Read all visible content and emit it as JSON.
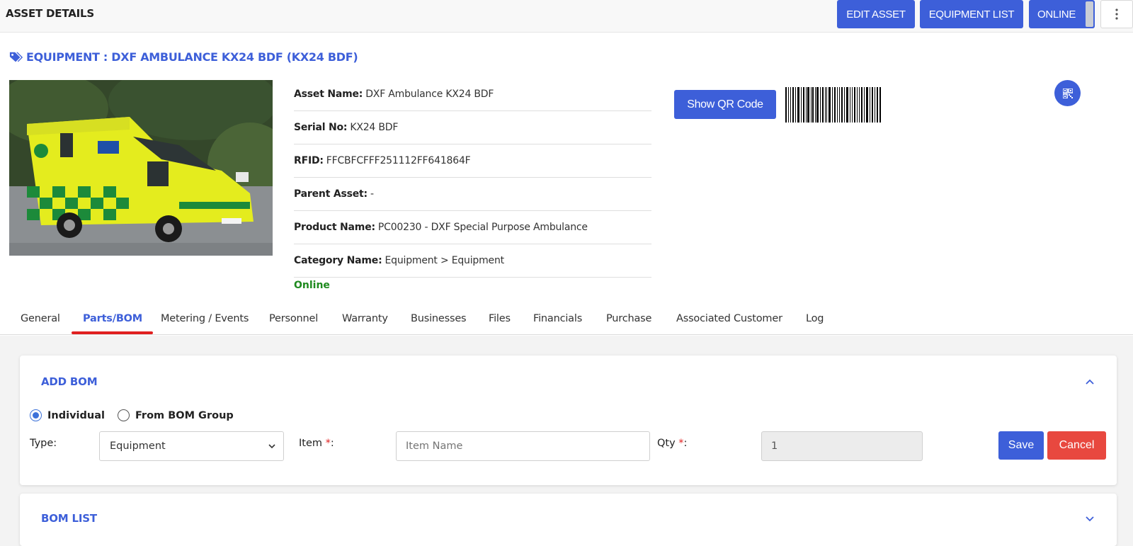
{
  "header": {
    "title": "ASSET DETAILS",
    "edit_asset": "EDIT ASSET",
    "equipment_list": "EQUIPMENT LIST",
    "online": "ONLINE",
    "more_icon": "more-vertical-icon"
  },
  "equipment": {
    "title": "EQUIPMENT : DXF AMBULANCE KX24 BDF (KX24 BDF)",
    "icon": "tag-icon",
    "details": [
      {
        "label": "Asset Name:",
        "value": "DXF Ambulance KX24 BDF"
      },
      {
        "label": "Serial No:",
        "value": "KX24 BDF"
      },
      {
        "label": "RFID:",
        "value": "FFCBFCFFF251112FF641864F"
      },
      {
        "label": "Parent Asset:",
        "value": "-"
      },
      {
        "label": "Product Name:",
        "value": "PC00230 - DXF Special Purpose Ambulance"
      },
      {
        "label": "Category Name:",
        "value": "Equipment > Equipment"
      }
    ],
    "status": "Online",
    "status_color": "#1f8a1f",
    "show_qr": "Show QR Code"
  },
  "tabs": [
    {
      "label": "General"
    },
    {
      "label": "Parts/BOM",
      "active": true
    },
    {
      "label": "Metering / Events"
    },
    {
      "label": "Personnel"
    },
    {
      "label": "Warranty"
    },
    {
      "label": "Businesses"
    },
    {
      "label": "Files"
    },
    {
      "label": "Financials"
    },
    {
      "label": "Purchase"
    },
    {
      "label": "Associated Customer"
    },
    {
      "label": "Log"
    }
  ],
  "add_bom": {
    "title": "ADD BOM",
    "radio_individual": "Individual",
    "radio_group": "From BOM Group",
    "type_label": "Type:",
    "type_value": "Equipment",
    "item_label": "Item ",
    "item_required": "*",
    "item_colon": ":",
    "item_placeholder": "Item Name",
    "qty_label": "Qty ",
    "qty_required": "*",
    "qty_colon": ":",
    "qty_value": "1",
    "save": "Save",
    "cancel": "Cancel"
  },
  "bom_list": {
    "title": "BOM LIST"
  },
  "colors": {
    "accent": "#3d5fd9",
    "danger": "#e8483f",
    "tab_underline": "#e02020"
  }
}
